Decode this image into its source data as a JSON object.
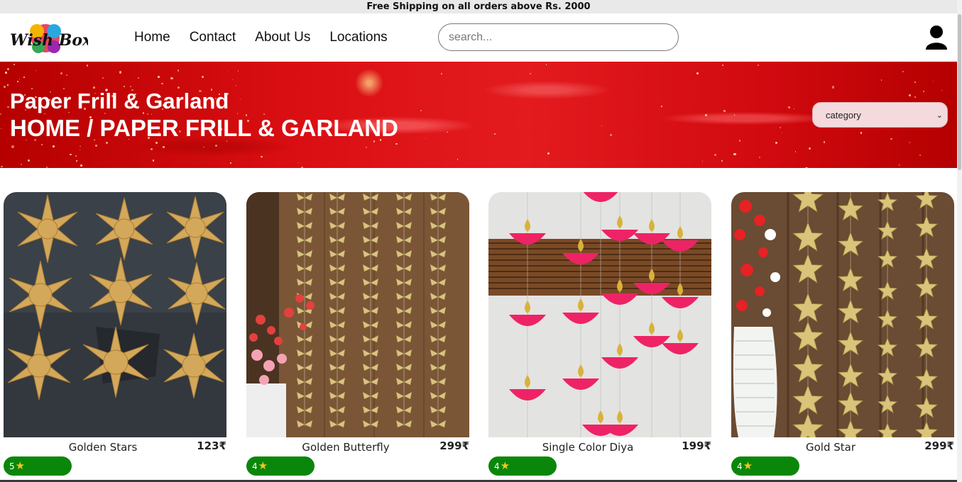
{
  "announcement": "Free Shipping on all orders above Rs. 2000",
  "brand": {
    "logo_text": "Wish Box"
  },
  "nav": {
    "items": [
      "Home",
      "Contact",
      "About Us",
      "Locations"
    ]
  },
  "search": {
    "placeholder": "search..."
  },
  "banner": {
    "title": "Paper Frill & Garland",
    "breadcrumb": "HOME / PAPER FRILL & GARLAND",
    "category_select": "category"
  },
  "products": [
    {
      "name": "Golden Stars",
      "price": "123₹",
      "rating": "5"
    },
    {
      "name": "Golden Butterfly",
      "price": "299₹",
      "rating": "4"
    },
    {
      "name": "Single Color Diya",
      "price": "199₹",
      "rating": "4"
    },
    {
      "name": "Gold Star",
      "price": "299₹",
      "rating": "4"
    }
  ],
  "colors": {
    "banner_red": "#d90e12",
    "rating_green": "#0a870a",
    "star_yellow": "#f7c51c"
  }
}
